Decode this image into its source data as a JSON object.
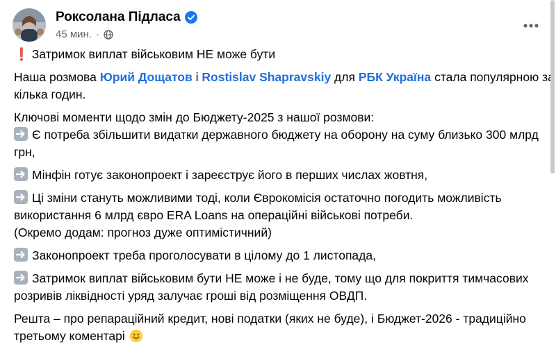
{
  "post": {
    "author": "Роксолана Підласа",
    "time": "45 мин.",
    "dot": "·",
    "content": {
      "headline": "Затримок виплат військовим НЕ може бути",
      "intro": {
        "prefix": "Наша розмова ",
        "link1": "Юрий Дощатов",
        "conj1": " і ",
        "link2": "Rostislav Shapravskiy",
        "conj2": " для ",
        "link3": "РБК Україна",
        "suffix_line1": " стала популярною за",
        "line2": "кілька годин."
      },
      "key_points_title": "Ключові моменти щодо змін до Бюджету-2025 з нашої розмови:",
      "points": [
        {
          "lines": [
            "Є потреба збільшити видатки державного бюджету на оборону на суму близько 300 млрд",
            "грн,"
          ]
        },
        {
          "lines": [
            "Мінфін готує законопроект і зареєструє його в перших числах жовтня,"
          ]
        },
        {
          "lines": [
            "Ці зміни стануть можливими тоді, коли Єврокомісія остаточно погодить можливість",
            "використання 6 млрд євро ERA Loans на операційні військові потреби.",
            "(Окремо додам: прогноз дуже оптимістичний)"
          ]
        },
        {
          "lines": [
            "Законопроект треба проголосувати в цілому до 1 листопада,"
          ]
        },
        {
          "lines": [
            "Затримок виплат військовим бути НЕ може і не буде, тому що для покриття тимчасових",
            "розривів ліквідності уряд залучає гроші від розміщення ОВДП."
          ]
        }
      ],
      "closing": [
        " Решта – про репараційний кредит, нові податки (яких не буде), і Бюджет-2026 - традиційно",
        "третьому коментарі"
      ]
    },
    "icons": {
      "verified": "verified-badge-icon",
      "globe": "globe-icon",
      "more": "more-horizontal-icon",
      "arrow": "right-arrow-icon",
      "exclamation": "red-exclamation-icon",
      "smile": "smile-emoji-icon"
    },
    "colors": {
      "link": "#216fdb",
      "verified": "#1877f2",
      "meta": "#65676b",
      "arrow_bg": "#a7b2bd",
      "exclamation": "#e0212b"
    }
  }
}
